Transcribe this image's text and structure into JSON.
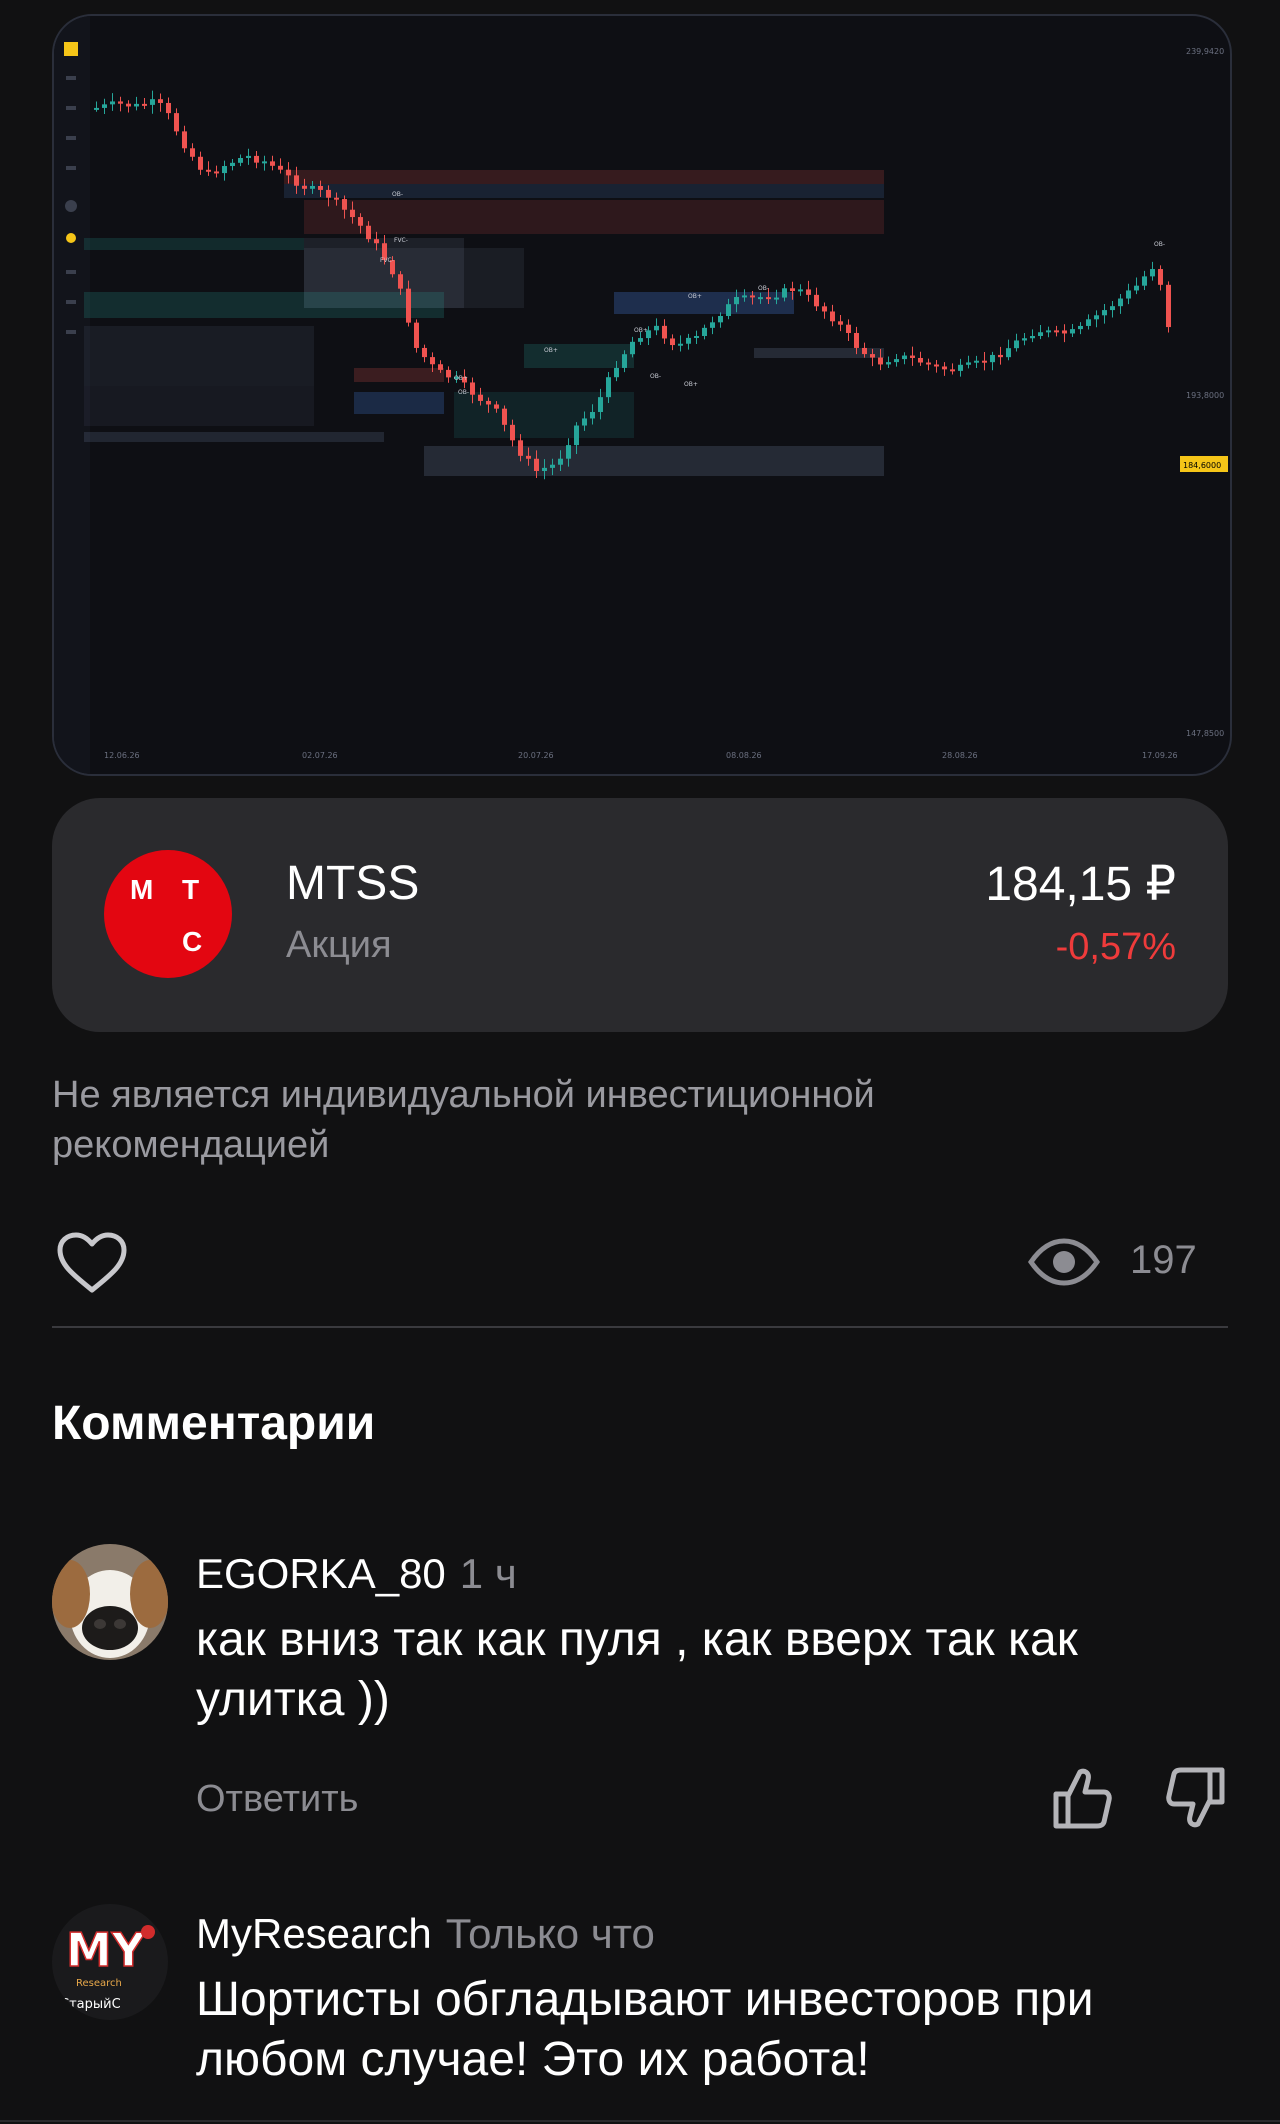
{
  "chart": {
    "date_labels": [
      "12.06.26",
      "02.07.26",
      "20.07.26",
      "08.08.26",
      "28.08.26",
      "17.09.26"
    ],
    "price_labels": [
      "239,9420",
      "193,8000",
      "147,8500"
    ],
    "current_price_tag": "184,6000",
    "zone_labels": [
      "OB-",
      "FVC-",
      "FVC-",
      "OB+",
      "OB+",
      "OB-",
      "OB-",
      "OB+",
      "OB+",
      "OB-",
      "OB+",
      "OB-"
    ],
    "colors": {
      "up": "#26a69a",
      "down": "#ef5350",
      "price_tag": "#f5c518"
    }
  },
  "instrument": {
    "logo_letters": [
      "М",
      "Т",
      "С"
    ],
    "ticker": "MTSS",
    "type": "Акция",
    "price": "184,15 ₽",
    "change": "-0,57%",
    "colors": {
      "logo_bg": "#e30611",
      "negative": "#ef3b3b"
    }
  },
  "disclaimer": "Не является индивидуальной инвестиционной рекомендацией",
  "stats": {
    "views": "197"
  },
  "comments_title": "Комментарии",
  "comments": [
    {
      "author": "EGORKA_80",
      "time": "1 ч",
      "text": "как вниз так как пуля , как вверх так как улитка ))",
      "reply_label": "Ответить"
    },
    {
      "author": "MyResearch",
      "time": "Только что",
      "text": "Шортисты обгладывают инвесторов при любом случае! Это их работа!",
      "avatar_text": "MY",
      "avatar_subtext": "Research",
      "avatar_caption": "СтарыйС"
    }
  ]
}
